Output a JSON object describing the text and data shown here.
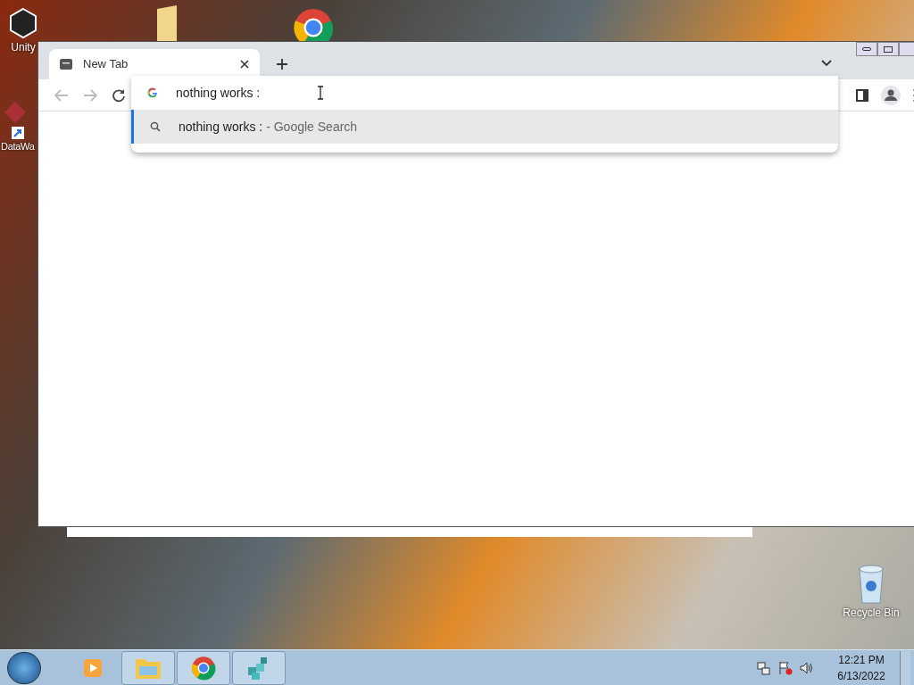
{
  "desktop_icons": [
    {
      "label": "Unity"
    },
    {
      "label": "DataWa"
    },
    {
      "label": "Recycle Bin"
    }
  ],
  "browser": {
    "tabs": [
      {
        "title": "New Tab",
        "selected": true
      }
    ],
    "omnibox": {
      "value": "nothing works :"
    },
    "suggestions": [
      {
        "query": "nothing works :",
        "suffix": "- Google Search",
        "selected": true
      }
    ]
  },
  "taskbar": {
    "buttons": [
      {
        "kind": "media"
      },
      {
        "kind": "explorer"
      },
      {
        "kind": "chrome"
      },
      {
        "kind": "registry"
      }
    ],
    "time": "12:21 PM",
    "date": "6/13/2022"
  }
}
